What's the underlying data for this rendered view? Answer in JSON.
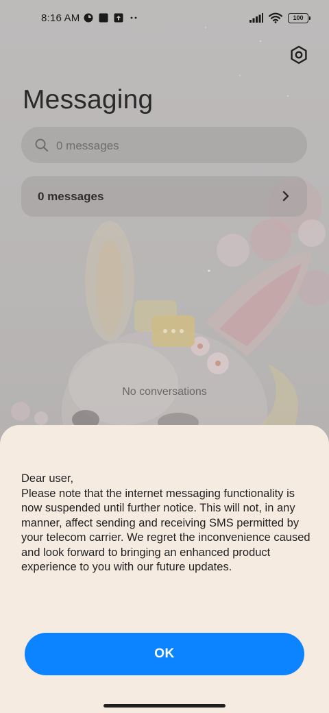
{
  "status_bar": {
    "time": "8:16 AM",
    "battery": "100",
    "left_icons": [
      "app-notification-icon",
      "square-notification-icon",
      "upload-notification-icon",
      "more-dots-icon"
    ],
    "right_icons": [
      "signal-icon",
      "wifi-icon",
      "battery-icon"
    ]
  },
  "header": {
    "title": "Messaging",
    "settings_icon": "settings-icon"
  },
  "search": {
    "placeholder": "0 messages"
  },
  "messages_row": {
    "label": "0 messages"
  },
  "empty_state": {
    "text": "No conversations"
  },
  "dialog": {
    "message": "Dear user,\nPlease note that the internet messaging functionality is now suspended until further notice. This will not, in any manner, affect sending and receiving SMS permitted by your telecom carrier. We regret the inconvenience caused and look forward to bringing an enhanced product experience to you with our future updates.",
    "ok_label": "OK"
  },
  "colors": {
    "accent": "#0d84ff",
    "dialog_background": "#f6ebe1",
    "scrim_background": "#b6b3b3"
  }
}
